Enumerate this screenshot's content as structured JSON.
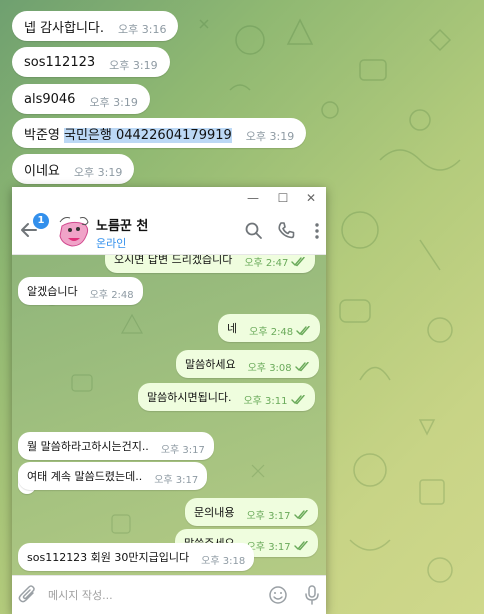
{
  "outer_chat": {
    "messages": [
      {
        "text": "넵 감사합니다.",
        "time": "오후 3:16"
      },
      {
        "text": "sos112123",
        "time": "오후 3:19"
      },
      {
        "text": "als9046",
        "time": "오후 3:19"
      },
      {
        "text_prefix": "박준영 ",
        "text_highlight": "국민은행 04422604179919",
        "time": "오후 3:19"
      },
      {
        "text": "이네요",
        "time": "오후 3:19"
      }
    ]
  },
  "window": {
    "controls": {
      "minimize": "—",
      "maximize": "☐",
      "close": "✕"
    },
    "header": {
      "badge_count": "1",
      "contact_name": "노름꾼 천",
      "contact_status": "온라인"
    },
    "messages": [
      {
        "direction": "out",
        "text": "오시면 답변 드리겠습니다",
        "time": "오후 2:47"
      },
      {
        "direction": "in",
        "text": "알겠습니다",
        "time": "오후 2:48"
      },
      {
        "direction": "out",
        "text": "네",
        "time": "오후 2:48"
      },
      {
        "direction": "out",
        "text": "말씀하세요",
        "time": "오후 3:08"
      },
      {
        "direction": "out",
        "text": "말씀하시면됩니다.",
        "time": "오후 3:11"
      },
      {
        "direction": "in",
        "text": "뭘 말씀하라고하시는건지..",
        "time": "오후 3:17"
      },
      {
        "direction": "in",
        "text": "여태 계속 말씀드렸는데..",
        "time": "오후 3:17"
      },
      {
        "direction": "out",
        "text": "문의내용",
        "time": "오후 3:17"
      },
      {
        "direction": "out",
        "text": "말씀주세요",
        "time": "오후 3:17"
      },
      {
        "direction": "in",
        "text": "sos112123 회원 30만지급입니다",
        "time": "오후 3:18"
      }
    ],
    "input": {
      "placeholder": "메시지 작성..."
    }
  },
  "colors": {
    "accent": "#3390ec",
    "outgoing_bubble": "#effdde",
    "incoming_bubble": "#ffffff",
    "read_check": "#6aaa5a",
    "highlight": "#bcd8f5"
  },
  "icons": [
    "back-arrow-icon",
    "search-icon",
    "phone-icon",
    "more-vertical-icon",
    "paperclip-icon",
    "emoji-icon",
    "microphone-icon",
    "double-check-icon"
  ]
}
